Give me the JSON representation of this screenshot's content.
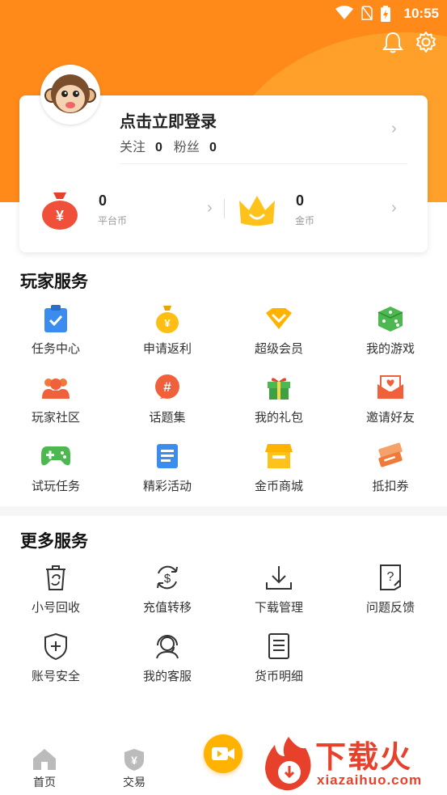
{
  "status_bar": {
    "time": "10:55"
  },
  "profile": {
    "login_prompt": "点击立即登录",
    "following_label": "关注",
    "following_count": "0",
    "fans_label": "粉丝",
    "fans_count": "0"
  },
  "wallet": {
    "platform_coin_value": "0",
    "platform_coin_label": "平台币",
    "gold_coin_value": "0",
    "gold_coin_label": "金币"
  },
  "player_services": {
    "title": "玩家服务",
    "items": [
      {
        "label": "任务中心",
        "icon": "clipboard-check-icon"
      },
      {
        "label": "申请返利",
        "icon": "yen-bag-icon"
      },
      {
        "label": "超级会员",
        "icon": "diamond-vip-icon"
      },
      {
        "label": "我的游戏",
        "icon": "dice-icon"
      },
      {
        "label": "玩家社区",
        "icon": "community-icon"
      },
      {
        "label": "话题集",
        "icon": "hashtag-icon"
      },
      {
        "label": "我的礼包",
        "icon": "gift-icon"
      },
      {
        "label": "邀请好友",
        "icon": "invite-envelope-icon"
      },
      {
        "label": "试玩任务",
        "icon": "gamepad-icon"
      },
      {
        "label": "精彩活动",
        "icon": "news-icon"
      },
      {
        "label": "金币商城",
        "icon": "store-icon"
      },
      {
        "label": "抵扣券",
        "icon": "ticket-icon"
      }
    ]
  },
  "more_services": {
    "title": "更多服务",
    "items": [
      {
        "label": "小号回收",
        "icon": "recycle-bin-icon"
      },
      {
        "label": "充值转移",
        "icon": "dollar-transfer-icon"
      },
      {
        "label": "下载管理",
        "icon": "download-icon"
      },
      {
        "label": "问题反馈",
        "icon": "feedback-icon"
      },
      {
        "label": "账号安全",
        "icon": "shield-plus-icon"
      },
      {
        "label": "我的客服",
        "icon": "headset-icon"
      },
      {
        "label": "货币明细",
        "icon": "list-detail-icon"
      }
    ]
  },
  "tabbar": {
    "home_label": "首页",
    "trade_label": "交易"
  },
  "watermark": {
    "brand": "下载火",
    "url": "xiazaihuo.com"
  },
  "colors": {
    "accent": "#FF8A1A",
    "accent_light": "#FFA02B",
    "watermark": "#E8412B"
  }
}
